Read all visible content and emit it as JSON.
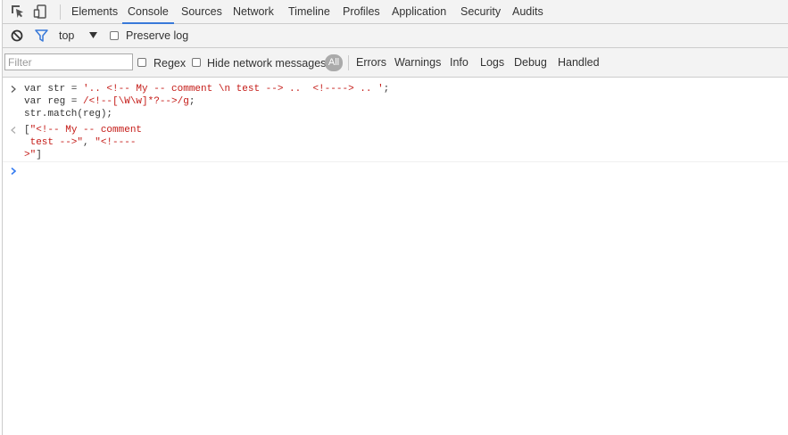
{
  "tabs": [
    {
      "label": "Elements"
    },
    {
      "label": "Console"
    },
    {
      "label": "Sources"
    },
    {
      "label": "Network"
    },
    {
      "label": "Timeline"
    },
    {
      "label": "Profiles"
    },
    {
      "label": "Application"
    },
    {
      "label": "Security"
    },
    {
      "label": "Audits"
    }
  ],
  "toolbar": {
    "context": "top",
    "preserve_log_label": "Preserve log"
  },
  "filterbar": {
    "filter_placeholder": "Filter",
    "regex_label": "Regex",
    "hide_network_label": "Hide network messages",
    "all_label": "All",
    "levels": [
      "Errors",
      "Warnings",
      "Info",
      "Logs",
      "Debug",
      "Handled"
    ]
  },
  "console": {
    "input": {
      "l1_a": "var str = ",
      "l1_b": "'.. <!-- My -- comment \\n test --> ..  <!----> .. '",
      "l1_c": ";",
      "l2_a": "var reg = ",
      "l2_b": "/<!--[\\W\\w]*?-->/g",
      "l2_c": ";",
      "l3": "str.match(reg);"
    },
    "output": {
      "l1_a": "[",
      "l1_b": "\"<!-- My -- comment",
      "l2_b": " test -->\"",
      "l2_sep": ", ",
      "l2_c": "\"<!----",
      "l3_b": ">\"",
      "l3_c": "]"
    }
  },
  "colors": {
    "accent": "#3879d9",
    "string": "#c41a16",
    "prompt": "#367cf1"
  }
}
